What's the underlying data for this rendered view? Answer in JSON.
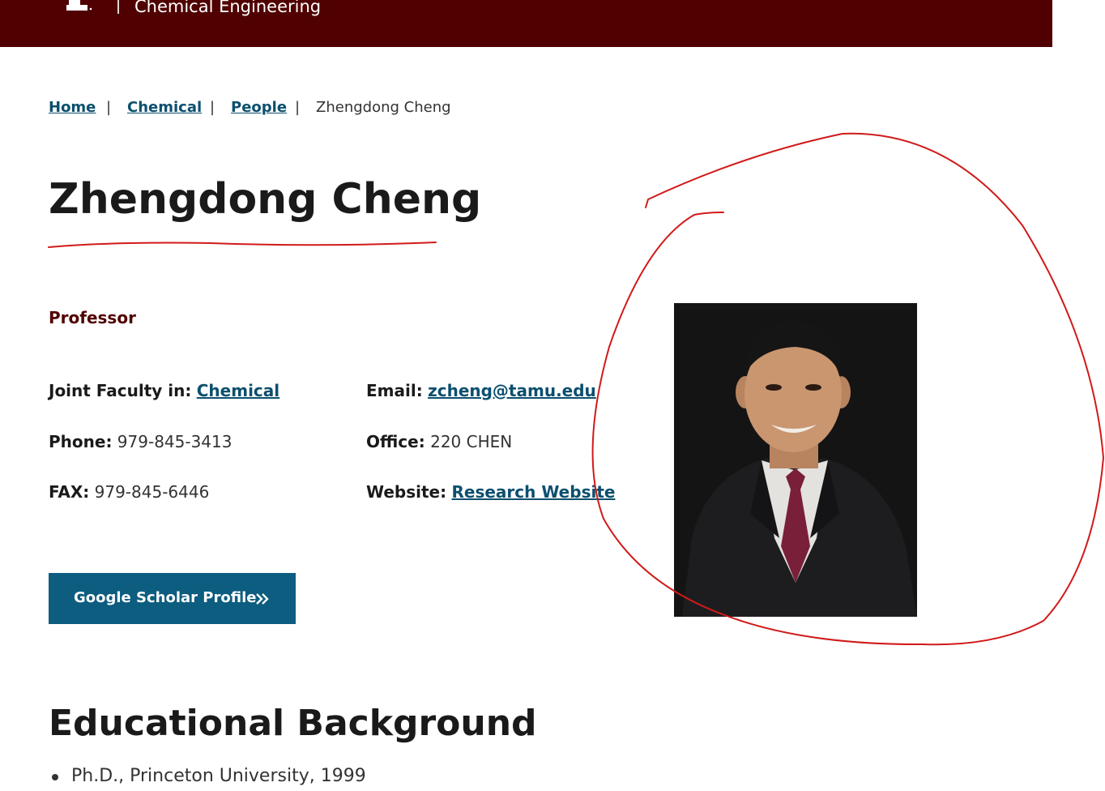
{
  "header": {
    "site_name": "Chemical Engineering"
  },
  "breadcrumb": {
    "items": [
      "Home",
      "Chemical",
      "People"
    ],
    "current": "Zhengdong Cheng"
  },
  "profile": {
    "name": "Zhengdong Cheng",
    "title": "Professor",
    "joint_faculty_label": "Joint Faculty in:",
    "joint_faculty_value": "Chemical",
    "email_label": "Email:",
    "email_value": "zcheng@tamu.edu",
    "phone_label": "Phone:",
    "phone_value": "979-845-3413",
    "office_label": "Office:",
    "office_value": "220 CHEN",
    "fax_label": "FAX:",
    "fax_value": "979-845-6446",
    "website_label": "Website:",
    "website_value": "Research Website",
    "scholar_button": "Google Scholar Profile"
  },
  "education": {
    "heading": "Educational Background",
    "items": [
      "Ph.D., Princeton University, 1999"
    ]
  },
  "colors": {
    "brand_maroon": "#500000",
    "link_blue": "#0c4f6e",
    "button_blue": "#0c5d7f",
    "annotation_red": "#d11a1a"
  }
}
